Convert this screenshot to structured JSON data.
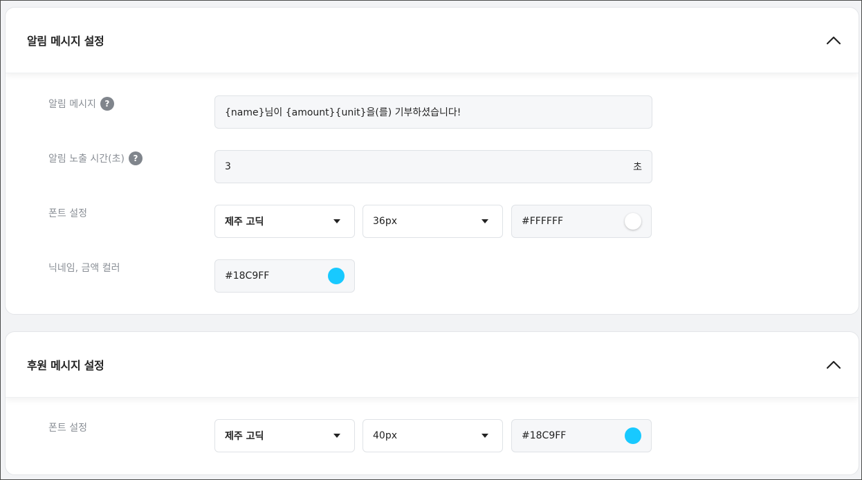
{
  "alert_section": {
    "title": "알림 메시지 설정",
    "message": {
      "label": "알림 메시지",
      "value": "{name}님이 {amount}{unit}을(를) 기부하셨습니다!"
    },
    "duration": {
      "label": "알림 노출 시간(초)",
      "value": "3",
      "unit": "초"
    },
    "font": {
      "label": "폰트 설정",
      "family": "제주 고딕",
      "size": "36px",
      "color": "#FFFFFF"
    },
    "highlight": {
      "label": "닉네임, 금액 컬러",
      "color": "#18C9FF"
    }
  },
  "donation_section": {
    "title": "후원 메시지 설정",
    "font": {
      "label": "폰트 설정",
      "family": "제주 고딕",
      "size": "40px",
      "color": "#18C9FF"
    }
  },
  "help_glyph": "?",
  "colors": {
    "accent": "#18C9FF",
    "white": "#FFFFFF"
  }
}
